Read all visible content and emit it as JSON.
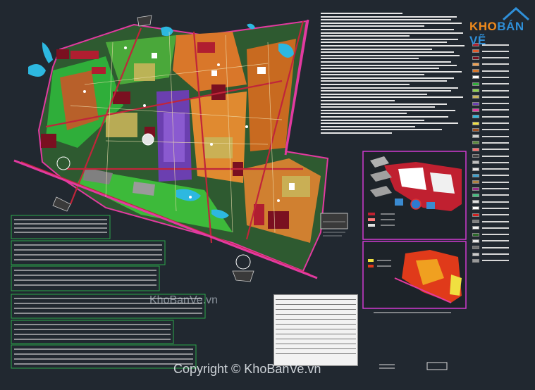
{
  "logo": {
    "part1": "KHO",
    "part2": "BÁN VẼ",
    "brand_orange": "#f08a1c",
    "brand_blue": "#2f8fd8"
  },
  "watermark": {
    "text": "KhoBanVe.vn"
  },
  "copyright": {
    "text": "Copyright © KhoBanVe.vn"
  },
  "colors": {
    "background": "#212830",
    "residential": "#d9772a",
    "green_space": "#2fae3a",
    "public_purple": "#6b3fb0",
    "water": "#2db8e0",
    "road_red": "#c0253a",
    "road_magenta": "#e23aa0",
    "commercial_red": "#b01e30",
    "dark_block": "#7a1020"
  },
  "legend": {
    "swatches": [
      "#b01e30",
      "#e05a2a",
      "#7a1020",
      "#f0a050",
      "#d9772a",
      "#ffffff",
      "#2fae3a",
      "#8bd24a",
      "#c8b45a",
      "#6b3fb0",
      "#e23aa0",
      "#2db8e0",
      "#f0e040",
      "#a05020",
      "#d0d0d0",
      "#5a8a3a",
      "#ff6a6a",
      "#444444",
      "#c0c0c0",
      "#e6e6e6",
      "#3aa0d0",
      "#b08040",
      "#9a2a8a",
      "#40c080",
      "#e0e0e0",
      "#ffffff",
      "#d02020",
      "#808080",
      "#f5f5f5",
      "#2a6a2a",
      "#e8e8e8",
      "#707070",
      "#cccccc",
      "#999999"
    ]
  }
}
